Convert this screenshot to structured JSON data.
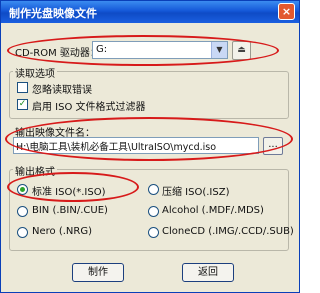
{
  "window": {
    "title": "制作光盘映像文件",
    "close_glyph": "×"
  },
  "drive": {
    "label": "CD-ROM 驱动器：",
    "value": "G:",
    "arrow": "▼",
    "eject": "⏏"
  },
  "read_options": {
    "title": "读取选项",
    "ignore_errors": "忽略读取错误",
    "enable_iso_filter": "启用 ISO 文件格式过滤器",
    "enable_iso_filter_checked": true,
    "check_glyph": "✓"
  },
  "output_file": {
    "title": "输出映像文件名：",
    "path": "H:\\电脑工具\\装机必备工具\\UltraISO\\mycd.iso",
    "browse": "..."
  },
  "output_format": {
    "title": "输出格式",
    "options": [
      "标准 ISO(*.ISO)",
      "压缩 ISO(.ISZ)",
      "BIN (.BIN/.CUE)",
      "Alcohol (.MDF/.MDS)",
      "Nero (.NRG)",
      "CloneCD (.IMG/.CCD/.SUB)"
    ],
    "selected_index": 0
  },
  "buttons": {
    "make": "制作",
    "back": "返回"
  },
  "colors": {
    "annotation": "#d71a1a",
    "title_bar": "#1458d8",
    "dialog_bg": "#ece9d8"
  }
}
